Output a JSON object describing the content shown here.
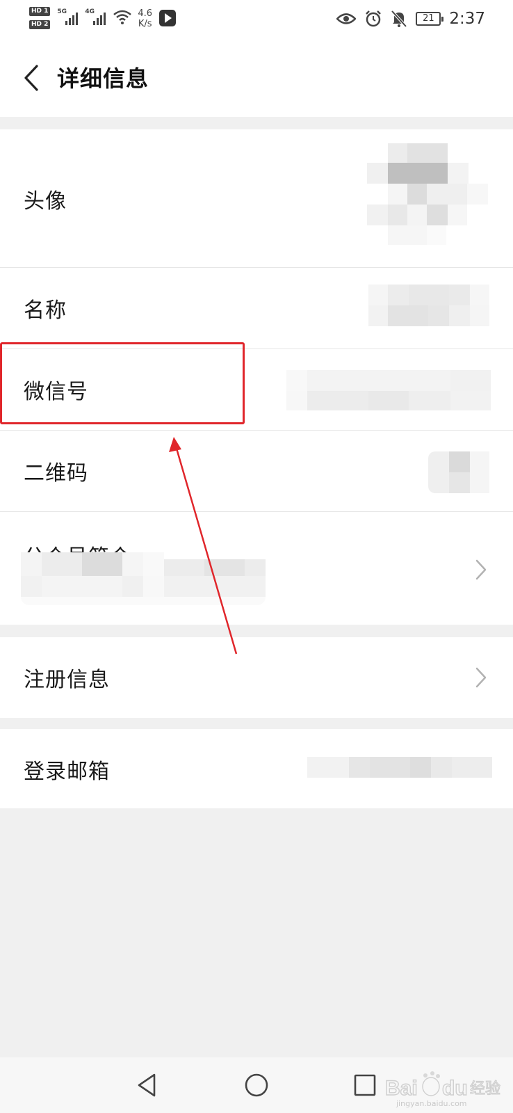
{
  "status_bar": {
    "hd1": "HD 1",
    "hd2": "HD 2",
    "sim1_label": "5G",
    "sim2_label": "4G",
    "speed_value": "4.6",
    "speed_unit": "K/s",
    "battery": "21",
    "time": "2:37",
    "icons": [
      "signal-icon",
      "wifi-icon",
      "app-notification-icon",
      "eye-icon",
      "alarm-icon",
      "mute-icon",
      "battery-icon"
    ]
  },
  "header": {
    "title": "详细信息",
    "back_icon": "chevron-left-icon"
  },
  "rows": [
    {
      "label": "头像",
      "value": "",
      "has_chevron": false
    },
    {
      "label": "名称",
      "value": "",
      "has_chevron": false
    },
    {
      "label": "微信号",
      "value": "",
      "has_chevron": false
    },
    {
      "label": "二维码",
      "value": "",
      "has_chevron": false
    },
    {
      "label": "公众号简介",
      "value": "",
      "has_chevron": true
    },
    {
      "label": "注册信息",
      "value": "",
      "has_chevron": true
    },
    {
      "label": "登录邮箱",
      "value": "",
      "has_chevron": false
    }
  ],
  "annotation": {
    "highlight_color": "#e0262b",
    "highlighted_row": "微信号"
  },
  "system_nav": {
    "icons": [
      "nav-back-icon",
      "nav-home-icon",
      "nav-recents-icon"
    ]
  },
  "watermark": {
    "brand": "Baidu 经验",
    "url": "jingyan.baidu.com"
  }
}
